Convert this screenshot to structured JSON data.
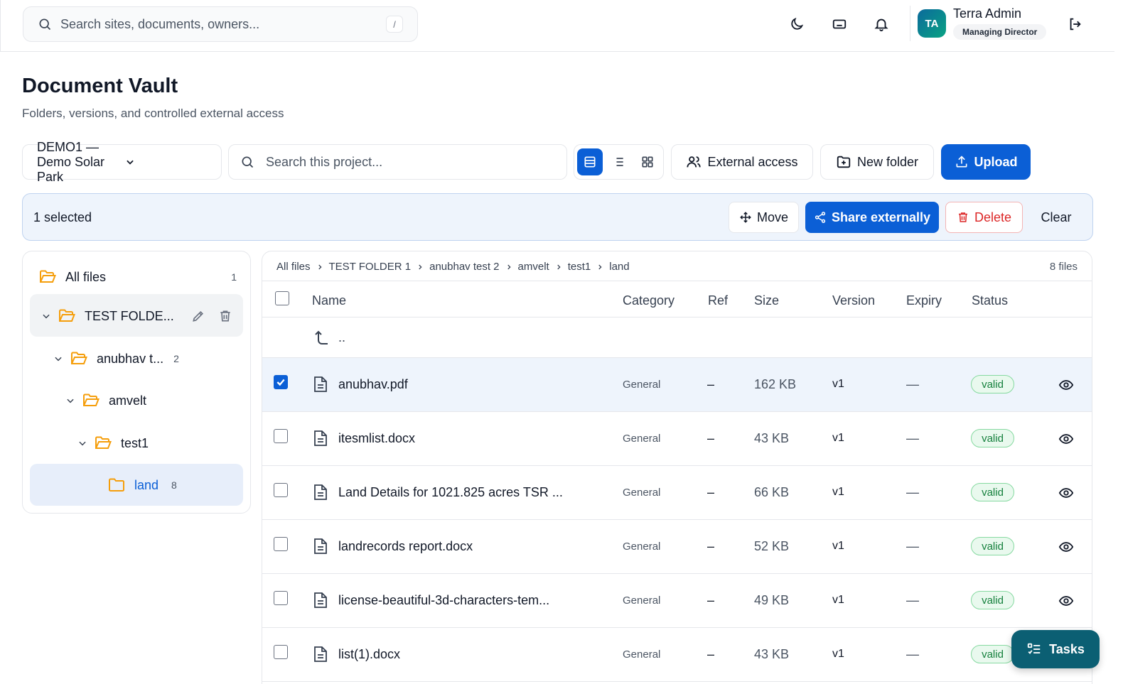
{
  "search": {
    "placeholder": "Search sites, documents, owners...",
    "shortcut": "/"
  },
  "user": {
    "initials": "TA",
    "name": "Terra Admin",
    "role": "Managing Director"
  },
  "page": {
    "title": "Document Vault",
    "subtitle": "Folders, versions, and controlled external access"
  },
  "toolbar": {
    "project": "DEMO1 — Demo Solar Park",
    "search_placeholder": "Search this project...",
    "external_access": "External access",
    "new_folder": "New folder",
    "upload": "Upload"
  },
  "selection": {
    "count_label": "1 selected",
    "move": "Move",
    "share": "Share externally",
    "delete": "Delete",
    "clear": "Clear"
  },
  "tree": {
    "all_files": {
      "label": "All files",
      "count": "1"
    },
    "items": [
      {
        "label": "TEST FOLDE...",
        "count": ""
      },
      {
        "label": "anubhav t...",
        "count": "2"
      },
      {
        "label": "amvelt",
        "count": ""
      },
      {
        "label": "test1",
        "count": ""
      },
      {
        "label": "land",
        "count": "8"
      }
    ]
  },
  "breadcrumb": [
    "All files",
    "TEST FOLDER 1",
    "anubhav test 2",
    "amvelt",
    "test1",
    "land"
  ],
  "file_count": "8 files",
  "columns": {
    "name": "Name",
    "category": "Category",
    "ref": "Ref",
    "size": "Size",
    "version": "Version",
    "expiry": "Expiry",
    "status": "Status"
  },
  "up_label": "..",
  "files": [
    {
      "name": "anubhav.pdf",
      "category": "General",
      "ref": "–",
      "size": "162 KB",
      "version": "v1",
      "expiry": "—",
      "status": "valid",
      "selected": true
    },
    {
      "name": "itesmlist.docx",
      "category": "General",
      "ref": "–",
      "size": "43 KB",
      "version": "v1",
      "expiry": "—",
      "status": "valid",
      "selected": false
    },
    {
      "name": "Land Details for 1021.825 acres TSR ...",
      "category": "General",
      "ref": "–",
      "size": "66 KB",
      "version": "v1",
      "expiry": "—",
      "status": "valid",
      "selected": false
    },
    {
      "name": "landrecords report.docx",
      "category": "General",
      "ref": "–",
      "size": "52 KB",
      "version": "v1",
      "expiry": "—",
      "status": "valid",
      "selected": false
    },
    {
      "name": "license-beautiful-3d-characters-tem...",
      "category": "General",
      "ref": "–",
      "size": "49 KB",
      "version": "v1",
      "expiry": "—",
      "status": "valid",
      "selected": false
    },
    {
      "name": "list(1).docx",
      "category": "General",
      "ref": "–",
      "size": "43 KB",
      "version": "v1",
      "expiry": "—",
      "status": "valid",
      "selected": false
    }
  ],
  "tasks_label": "Tasks",
  "colors": {
    "accent": "#0b5fd6",
    "selected_bg": "#eef4fc",
    "folder": "#f59e0b",
    "danger": "#dc2626",
    "success": "#15803d",
    "tasks": "#0b5f73"
  }
}
